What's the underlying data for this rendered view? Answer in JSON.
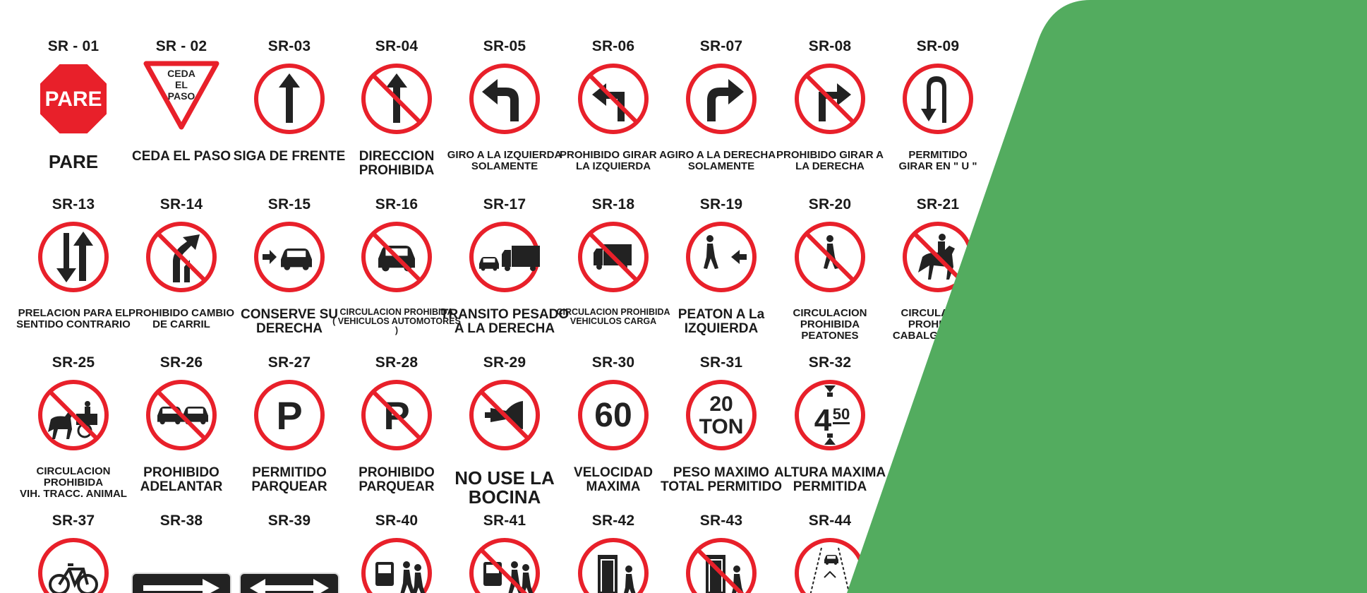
{
  "colors": {
    "red": "#e8202a",
    "black": "#222222",
    "green": "#53ac5f",
    "white": "#ffffff"
  },
  "signs": [
    {
      "code": "SR - 01",
      "caption": "PARE",
      "icon": "stop-octagon-icon",
      "sign_text": "PARE",
      "cap_size": "big"
    },
    {
      "code": "SR - 02",
      "caption": "CEDA EL PASO",
      "icon": "yield-triangle-icon",
      "sign_text": "CEDA\nEL\nPASO",
      "cap_size": "med"
    },
    {
      "code": "SR-03",
      "caption": "SIGA DE FRENTE",
      "icon": "arrow-up-icon",
      "cap_size": "med"
    },
    {
      "code": "SR-04",
      "caption": "DIRECCION\nPROHIBIDA",
      "icon": "no-straight-icon",
      "cap_size": "med"
    },
    {
      "code": "SR-05",
      "caption": "GIRO A LA IZQUIERDA\nSOLAMENTE",
      "icon": "turn-left-icon",
      "cap_size": "sm"
    },
    {
      "code": "SR-06",
      "caption": "PROHIBIDO GIRAR A\nLA IZQUIERDA",
      "icon": "no-left-turn-icon",
      "cap_size": "sm"
    },
    {
      "code": "SR-07",
      "caption": "GIRO A LA DERECHA\nSOLAMENTE",
      "icon": "turn-right-icon",
      "cap_size": "sm"
    },
    {
      "code": "SR-08",
      "caption": "PROHIBIDO GIRAR A\nLA DERECHA",
      "icon": "no-right-turn-icon",
      "cap_size": "sm"
    },
    {
      "code": "SR-09",
      "caption": "PERMITIDO\nGIRAR EN \" U \"",
      "icon": "u-turn-icon",
      "cap_size": "sm"
    },
    {
      "code": "SR-13",
      "caption": "PRELACION PARA EL\nSENTIDO CONTRARIO",
      "icon": "two-way-priority-icon",
      "cap_size": "sm"
    },
    {
      "code": "SR-14",
      "caption": "PROHIBIDO CAMBIO\nDE CARRIL",
      "icon": "no-lane-change-icon",
      "cap_size": "sm"
    },
    {
      "code": "SR-15",
      "caption": "CONSERVE SU\nDERECHA",
      "icon": "keep-right-car-icon",
      "cap_size": "med"
    },
    {
      "code": "SR-16",
      "caption": "CIRCULACION PROHIBIDA\n( VEHICULOS AUTOMOTORES )",
      "icon": "no-cars-icon",
      "cap_size": "xs"
    },
    {
      "code": "SR-17",
      "caption": "TRANSITO PESADO\nA LA DERECHA",
      "icon": "truck-right-icon",
      "cap_size": "med"
    },
    {
      "code": "SR-18",
      "caption": "CIRCULACION PROHIBIDA\nVEHICULOS CARGA",
      "icon": "no-trucks-icon",
      "cap_size": "xs"
    },
    {
      "code": "SR-19",
      "caption": "PEATON A La\nIZQUIERDA",
      "icon": "pedestrian-left-icon",
      "cap_size": "med"
    },
    {
      "code": "SR-20",
      "caption": "CIRCULACION\nPROHIBIDA\nPEATONES",
      "icon": "no-pedestrians-icon",
      "cap_size": "sm"
    },
    {
      "code": "SR-21",
      "caption": "CIRCULACION\nPROHIBIDA\nCABALGADURAS",
      "icon": "no-horses-icon",
      "cap_size": "sm"
    },
    {
      "code": "SR-25",
      "caption": "CIRCULACION\nPROHIBIDA\nVIH. TRACC. ANIMAL",
      "icon": "no-animal-carts-icon",
      "cap_size": "sm"
    },
    {
      "code": "SR-26",
      "caption": "PROHIBIDO\nADELANTAR",
      "icon": "no-overtaking-icon",
      "cap_size": "med"
    },
    {
      "code": "SR-27",
      "caption": "PERMITIDO\nPARQUEAR",
      "icon": "parking-icon",
      "cap_size": "med"
    },
    {
      "code": "SR-28",
      "caption": "PROHIBIDO\nPARQUEAR",
      "icon": "no-parking-icon",
      "cap_size": "med"
    },
    {
      "code": "SR-29",
      "caption": "NO USE LA\nBOCINA",
      "icon": "no-horn-icon",
      "cap_size": "big"
    },
    {
      "code": "SR-30",
      "caption": "VELOCIDAD\nMAXIMA",
      "icon": "speed-limit-icon",
      "sign_text": "60",
      "cap_size": "med"
    },
    {
      "code": "SR-31",
      "caption": "PESO MAXIMO\nTOTAL PERMITIDO",
      "icon": "weight-limit-icon",
      "sign_text": "20\nTON",
      "cap_size": "med"
    },
    {
      "code": "SR-32",
      "caption": "ALTURA MAXIMA\nPERMITIDA",
      "icon": "height-limit-icon",
      "sign_text": "450",
      "cap_size": "med"
    },
    {
      "code": "SR-37",
      "caption": "",
      "icon": "bicycle-icon",
      "cap_size": "med"
    },
    {
      "code": "SR-38",
      "caption": "",
      "icon": "one-way-arrow-icon",
      "cap_size": "med"
    },
    {
      "code": "SR-39",
      "caption": "",
      "icon": "two-way-arrow-icon",
      "cap_size": "med"
    },
    {
      "code": "SR-40",
      "caption": "",
      "icon": "bus-stop-icon",
      "cap_size": "med"
    },
    {
      "code": "SR-41",
      "caption": "",
      "icon": "no-bus-stop-icon",
      "cap_size": "med"
    },
    {
      "code": "SR-42",
      "caption": "",
      "icon": "loading-zone-icon",
      "cap_size": "med"
    },
    {
      "code": "SR-43",
      "caption": "",
      "icon": "no-loading-zone-icon",
      "cap_size": "med"
    },
    {
      "code": "SR-44",
      "caption": "",
      "icon": "bike-lane-icon",
      "cap_size": "med"
    }
  ]
}
